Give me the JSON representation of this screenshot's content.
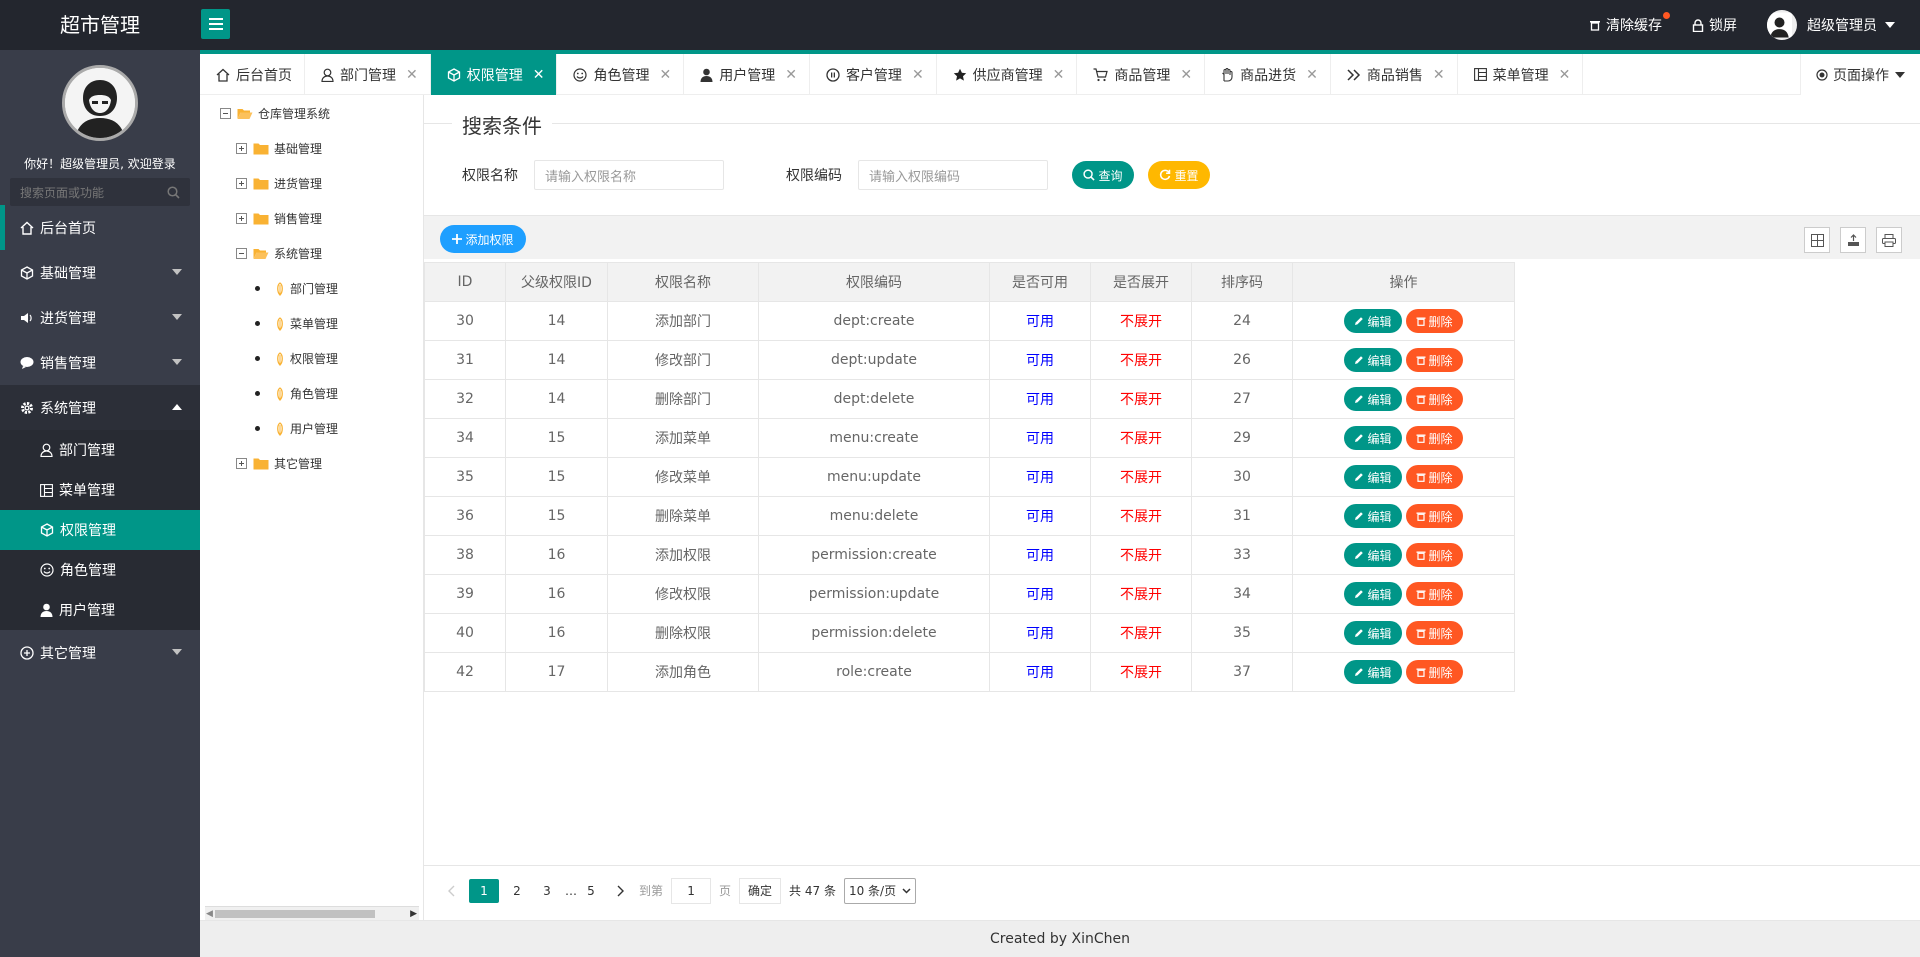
{
  "app": {
    "title": "超市管理"
  },
  "topbar": {
    "clear_cache": "清除缓存",
    "lock_screen": "锁屏",
    "admin_name": "超级管理员"
  },
  "sidebar": {
    "welcome": "你好！超级管理员, 欢迎登录",
    "search_placeholder": "搜索页面或功能",
    "items": [
      {
        "label": "后台首页",
        "icon": "home-icon"
      },
      {
        "label": "基础管理",
        "icon": "cube-icon"
      },
      {
        "label": "进货管理",
        "icon": "speaker-icon"
      },
      {
        "label": "销售管理",
        "icon": "chat-icon"
      },
      {
        "label": "系统管理",
        "icon": "gear-icon"
      }
    ],
    "sub_items": [
      {
        "label": "部门管理",
        "icon": "user-outline-icon"
      },
      {
        "label": "菜单管理",
        "icon": "menu-table-icon"
      },
      {
        "label": "权限管理",
        "icon": "cube-icon"
      },
      {
        "label": "角色管理",
        "icon": "smile-icon"
      },
      {
        "label": "用户管理",
        "icon": "user-icon"
      }
    ],
    "other": {
      "label": "其它管理",
      "icon": "other-icon"
    }
  },
  "tabs": [
    {
      "label": "后台首页",
      "closable": false
    },
    {
      "label": "部门管理",
      "closable": true
    },
    {
      "label": "权限管理",
      "closable": true,
      "active": true
    },
    {
      "label": "角色管理",
      "closable": true
    },
    {
      "label": "用户管理",
      "closable": true
    },
    {
      "label": "客户管理",
      "closable": true
    },
    {
      "label": "供应商管理",
      "closable": true
    },
    {
      "label": "商品管理",
      "closable": true
    },
    {
      "label": "商品进货",
      "closable": true
    },
    {
      "label": "商品销售",
      "closable": true
    },
    {
      "label": "菜单管理",
      "closable": true
    }
  ],
  "tab_close": "✕",
  "page_ops": "页面操作",
  "tree": {
    "root": "仓库管理系统",
    "nodes": [
      "基础管理",
      "进货管理",
      "销售管理",
      "系统管理",
      "其它管理"
    ],
    "children": [
      "部门管理",
      "菜单管理",
      "权限管理",
      "角色管理",
      "用户管理"
    ]
  },
  "search": {
    "legend": "搜索条件",
    "name_label": "权限名称",
    "name_placeholder": "请输入权限名称",
    "code_label": "权限编码",
    "code_placeholder": "请输入权限编码",
    "query_btn": "查询",
    "reset_btn": "重置"
  },
  "toolbar": {
    "add_btn": "添加权限"
  },
  "table": {
    "columns": [
      "ID",
      "父级权限ID",
      "权限名称",
      "权限编码",
      "是否可用",
      "是否展开",
      "排序码",
      "操作"
    ],
    "rows": [
      [
        "30",
        "14",
        "添加部门",
        "dept:create",
        "可用",
        "不展开",
        "24"
      ],
      [
        "31",
        "14",
        "修改部门",
        "dept:update",
        "可用",
        "不展开",
        "26"
      ],
      [
        "32",
        "14",
        "删除部门",
        "dept:delete",
        "可用",
        "不展开",
        "27"
      ],
      [
        "34",
        "15",
        "添加菜单",
        "menu:create",
        "可用",
        "不展开",
        "29"
      ],
      [
        "35",
        "15",
        "修改菜单",
        "menu:update",
        "可用",
        "不展开",
        "30"
      ],
      [
        "36",
        "15",
        "删除菜单",
        "menu:delete",
        "可用",
        "不展开",
        "31"
      ],
      [
        "38",
        "16",
        "添加权限",
        "permission:create",
        "可用",
        "不展开",
        "33"
      ],
      [
        "39",
        "16",
        "修改权限",
        "permission:update",
        "可用",
        "不展开",
        "34"
      ],
      [
        "40",
        "16",
        "删除权限",
        "permission:delete",
        "可用",
        "不展开",
        "35"
      ],
      [
        "42",
        "17",
        "添加角色",
        "role:create",
        "可用",
        "不展开",
        "37"
      ]
    ],
    "edit_label": "编辑",
    "delete_label": "删除"
  },
  "pager": {
    "pages": [
      "1",
      "2",
      "3"
    ],
    "ellipsis": "…",
    "last": "5",
    "goto_label": "到第",
    "page_value": "1",
    "page_unit": "页",
    "confirm": "确定",
    "total": "共 47 条",
    "per_page": "10 条/页"
  },
  "footer": {
    "text": "Created by XinChen"
  },
  "colors": {
    "accent": "#009688",
    "danger": "#ff5722",
    "warn": "#ffb800",
    "blue": "#1e9fff",
    "dark": "#393d49",
    "top": "#23262e"
  }
}
